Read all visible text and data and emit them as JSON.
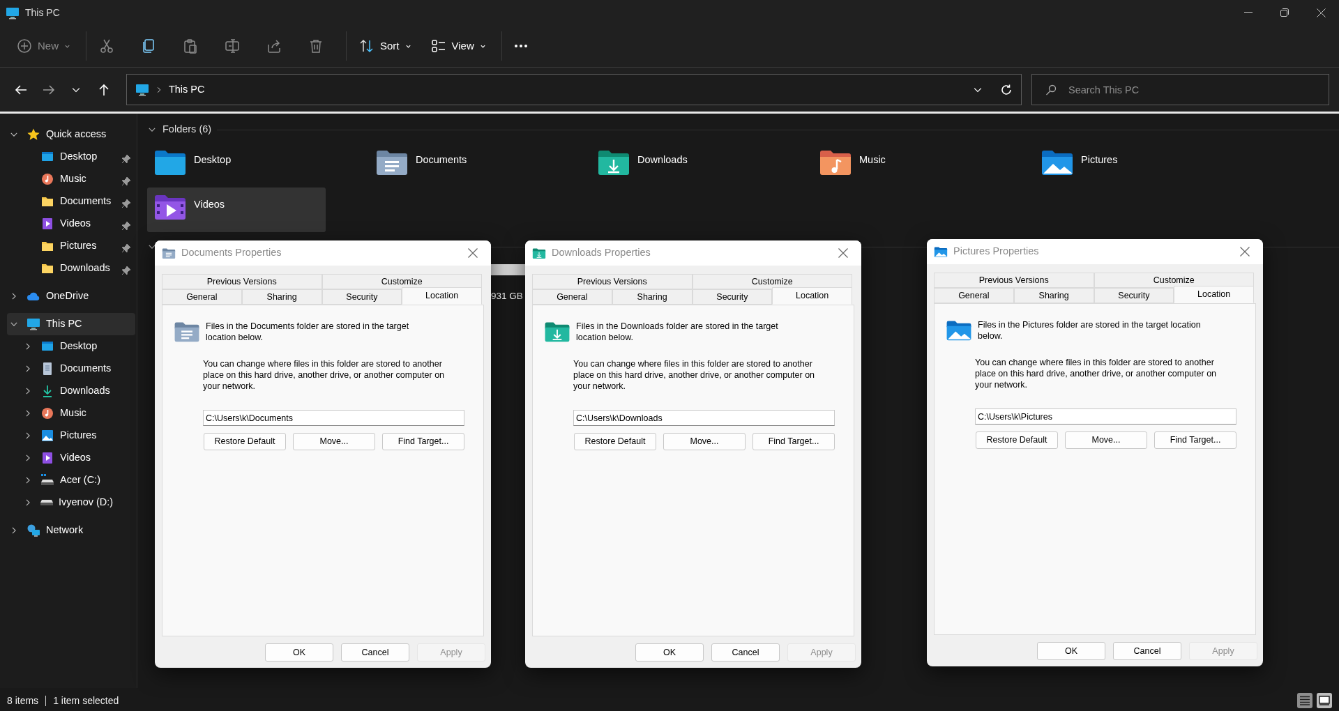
{
  "window": {
    "title": "This PC"
  },
  "toolbar": [
    {
      "kind": "new",
      "label": "New",
      "disabled": true
    },
    {
      "kind": "cut",
      "disabled": true
    },
    {
      "kind": "copy",
      "disabled": false
    },
    {
      "kind": "paste",
      "disabled": true
    },
    {
      "kind": "rename",
      "disabled": true
    },
    {
      "kind": "share",
      "disabled": true
    },
    {
      "kind": "delete",
      "disabled": true
    },
    {
      "kind": "sort",
      "label": "Sort",
      "disabled": false
    },
    {
      "kind": "view",
      "label": "View",
      "disabled": false
    },
    {
      "kind": "more",
      "disabled": false
    }
  ],
  "address": {
    "location": "This PC"
  },
  "search": {
    "placeholder": "Search This PC"
  },
  "sidebar": {
    "items": [
      {
        "label": "Quick access",
        "kind": "star",
        "expanded": true,
        "selected": false,
        "children": [
          {
            "label": "Desktop",
            "kind": "desktop",
            "pinned": true,
            "selected": false
          },
          {
            "label": "Music",
            "kind": "music",
            "pinned": true,
            "selected": false
          },
          {
            "label": "Documents",
            "kind": "folder",
            "pinned": true,
            "selected": false
          },
          {
            "label": "Videos",
            "kind": "videos",
            "pinned": true,
            "selected": false
          },
          {
            "label": "Pictures",
            "kind": "folder",
            "pinned": true,
            "selected": false
          },
          {
            "label": "Downloads",
            "kind": "folder",
            "pinned": true,
            "selected": false
          }
        ]
      },
      {
        "label": "OneDrive",
        "kind": "cloud",
        "expanded": false,
        "selected": false
      },
      {
        "label": "This PC",
        "kind": "pc",
        "expanded": true,
        "selected": true,
        "children": [
          {
            "label": "Desktop",
            "kind": "desktop",
            "expanded": false,
            "selected": false
          },
          {
            "label": "Documents",
            "kind": "documents",
            "expanded": false,
            "selected": false
          },
          {
            "label": "Downloads",
            "kind": "downloads",
            "expanded": false,
            "selected": false
          },
          {
            "label": "Music",
            "kind": "music",
            "expanded": false,
            "selected": false
          },
          {
            "label": "Pictures",
            "kind": "pictures",
            "expanded": false,
            "selected": false
          },
          {
            "label": "Videos",
            "kind": "videos",
            "expanded": false,
            "selected": false
          },
          {
            "label": "Acer (C:)",
            "kind": "osdrive",
            "expanded": false,
            "selected": false
          },
          {
            "label": "Ivyenov (D:)",
            "kind": "drive",
            "expanded": false,
            "selected": false
          }
        ]
      },
      {
        "label": "Network",
        "kind": "network",
        "expanded": false,
        "selected": false
      }
    ]
  },
  "folders_section": {
    "title": "Folders (6)",
    "expanded": true,
    "folders": [
      {
        "name": "Desktop",
        "kind": "desktop",
        "selected": false
      },
      {
        "name": "Documents",
        "kind": "documents",
        "selected": false
      },
      {
        "name": "Downloads",
        "kind": "downloads",
        "selected": false
      },
      {
        "name": "Music",
        "kind": "music",
        "selected": false
      },
      {
        "name": "Pictures",
        "kind": "pictures",
        "selected": false
      },
      {
        "name": "Videos",
        "kind": "videos",
        "selected": true
      }
    ]
  },
  "devices_section": {
    "expanded": true,
    "drive_capacity": "931 GB"
  },
  "dialogs": [
    {
      "title": "Documents Properties",
      "kind": "documents",
      "tab_rows": [
        [
          {
            "label": "Previous Versions",
            "selected": false
          },
          {
            "label": "Customize",
            "selected": false
          }
        ],
        [
          {
            "label": "General",
            "selected": false
          },
          {
            "label": "Sharing",
            "selected": false
          },
          {
            "label": "Security",
            "selected": false
          },
          {
            "label": "Location",
            "selected": true
          }
        ]
      ],
      "intro": "Files in the Documents folder are stored in the target location below.",
      "explanation": "You can change where files in this folder are stored to another place on this hard drive, another drive, or another computer on your network.",
      "path": "C:\\Users\\k\\Documents",
      "actions": [
        "Restore Default",
        "Move...",
        "Find Target..."
      ],
      "footer": [
        {
          "label": "OK",
          "disabled": false
        },
        {
          "label": "Cancel",
          "disabled": false
        },
        {
          "label": "Apply",
          "disabled": true
        }
      ]
    },
    {
      "title": "Downloads Properties",
      "kind": "downloads",
      "tab_rows": [
        [
          {
            "label": "Previous Versions",
            "selected": false
          },
          {
            "label": "Customize",
            "selected": false
          }
        ],
        [
          {
            "label": "General",
            "selected": false
          },
          {
            "label": "Sharing",
            "selected": false
          },
          {
            "label": "Security",
            "selected": false
          },
          {
            "label": "Location",
            "selected": true
          }
        ]
      ],
      "intro": "Files in the Downloads folder are stored in the target location below.",
      "explanation": "You can change where files in this folder are stored to another place on this hard drive, another drive, or another computer on your network.",
      "path": "C:\\Users\\k\\Downloads",
      "actions": [
        "Restore Default",
        "Move...",
        "Find Target..."
      ],
      "footer": [
        {
          "label": "OK",
          "disabled": false
        },
        {
          "label": "Cancel",
          "disabled": false
        },
        {
          "label": "Apply",
          "disabled": true
        }
      ]
    },
    {
      "title": "Pictures Properties",
      "kind": "pictures",
      "tab_rows": [
        [
          {
            "label": "Previous Versions",
            "selected": false
          },
          {
            "label": "Customize",
            "selected": false
          }
        ],
        [
          {
            "label": "General",
            "selected": false
          },
          {
            "label": "Sharing",
            "selected": false
          },
          {
            "label": "Security",
            "selected": false
          },
          {
            "label": "Location",
            "selected": true
          }
        ]
      ],
      "intro": "Files in the Pictures folder are stored in the target location below.",
      "explanation": "You can change where files in this folder are stored to another place on this hard drive, another drive, or another computer on your network.",
      "path": "C:\\Users\\k\\Pictures",
      "actions": [
        "Restore Default",
        "Move...",
        "Find Target..."
      ],
      "footer": [
        {
          "label": "OK",
          "disabled": false
        },
        {
          "label": "Cancel",
          "disabled": false
        },
        {
          "label": "Apply",
          "disabled": true
        }
      ]
    }
  ],
  "status_bar": {
    "item_count": "8 items",
    "selection": "1 item selected",
    "views": [
      {
        "kind": "details",
        "selected": false
      },
      {
        "kind": "tiles",
        "selected": true
      }
    ]
  }
}
